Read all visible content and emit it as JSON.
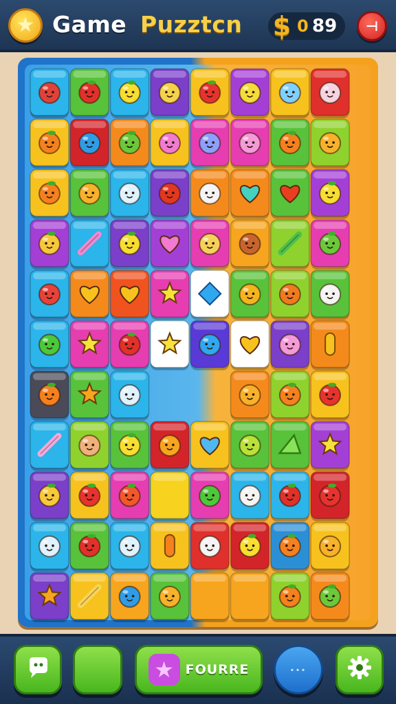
{
  "header": {
    "title_word": "Game",
    "title_name": "Puzztcn",
    "star_icon": "star-icon",
    "coin_icon": "coin-icon",
    "coin_symbol": "$",
    "coin_prefix": "0",
    "coin_count": "89",
    "menu_icon": "menu-icon",
    "menu_glyph": "⊣"
  },
  "board": {
    "columns": 8,
    "rows": 11,
    "grid": [
      [
        {
          "bg": "#2bb5ea",
          "icon": "monster-red"
        },
        {
          "bg": "#58c23a",
          "icon": "apple"
        },
        {
          "bg": "#2bb5ea",
          "icon": "lemon"
        },
        {
          "bg": "#7b3fc9",
          "icon": "potion"
        },
        {
          "bg": "#f7c21e",
          "icon": "strawberry"
        },
        {
          "bg": "#a43fd6",
          "icon": "lemon-smile"
        },
        {
          "bg": "#f7c21e",
          "icon": "cup"
        },
        {
          "bg": "#e0302c",
          "icon": "radish"
        }
      ],
      [
        {
          "bg": "#f7c21e",
          "icon": "orange"
        },
        {
          "bg": "#d3242a",
          "icon": "blue-blob"
        },
        {
          "bg": "#f58a1c",
          "icon": "lime"
        },
        {
          "bg": "#f7c21e",
          "icon": "pink-blob"
        },
        {
          "bg": "#e63db1",
          "icon": "muffin"
        },
        {
          "bg": "#e63db1",
          "icon": "pink-egg"
        },
        {
          "bg": "#58c23a",
          "icon": "orange"
        },
        {
          "bg": "#8fd22e",
          "icon": "orange-ball"
        }
      ],
      [
        {
          "bg": "#f7c21e",
          "icon": "orange"
        },
        {
          "bg": "#58c23a",
          "icon": "orange-ball"
        },
        {
          "bg": "#2bb5ea",
          "icon": "snowflake"
        },
        {
          "bg": "#7b3fc9",
          "icon": "red-drop"
        },
        {
          "bg": "#f58a1c",
          "icon": "radish-white"
        },
        {
          "bg": "#f58a1c",
          "icon": "heart-teal"
        },
        {
          "bg": "#58c23a",
          "icon": "heart-red"
        },
        {
          "bg": "#a43fd6",
          "icon": "lemon"
        }
      ],
      [
        {
          "bg": "#a43fd6",
          "icon": "pineapple"
        },
        {
          "bg": "#2bb5ea",
          "icon": "brush"
        },
        {
          "bg": "#7b3fc9",
          "icon": "lemon"
        },
        {
          "bg": "#a43fd6",
          "icon": "heart-pink"
        },
        {
          "bg": "#e63db1",
          "icon": "peanut"
        },
        {
          "bg": "#f7a51e",
          "icon": "cookie"
        },
        {
          "bg": "#8fd22e",
          "icon": "pencil"
        },
        {
          "bg": "#e63db1",
          "icon": "lime"
        }
      ],
      [
        {
          "bg": "#2bb5ea",
          "icon": "jar-red"
        },
        {
          "bg": "#f58a1c",
          "icon": "heart-yellow"
        },
        {
          "bg": "#f0531e",
          "icon": "heart-yellow"
        },
        {
          "bg": "#e63db1",
          "icon": "star-yellow"
        },
        {
          "bg": "#ffffff",
          "icon": "diamond"
        },
        {
          "bg": "#58c23a",
          "icon": "onion"
        },
        {
          "bg": "#8fd22e",
          "icon": "pumpkin"
        },
        {
          "bg": "#58c23a",
          "icon": "marshmallow"
        }
      ],
      [
        {
          "bg": "#2bb5ea",
          "icon": "green-monster"
        },
        {
          "bg": "#e63db1",
          "icon": "star-yellow"
        },
        {
          "bg": "#e63db1",
          "icon": "apple"
        },
        {
          "bg": "#ffffff",
          "icon": "star-yellow"
        },
        {
          "bg": "#5a3ad6",
          "icon": "drop-blue"
        },
        {
          "bg": "#ffffff",
          "icon": "heart-yellow"
        },
        {
          "bg": "#7b3fc9",
          "icon": "pink-monster"
        },
        {
          "bg": "#f58a1c",
          "icon": "capsule"
        }
      ],
      [
        {
          "bg": "#4a4a58",
          "icon": "orange"
        },
        {
          "bg": "#58c23a",
          "icon": "star-orange"
        },
        {
          "bg": "#2bb5ea",
          "icon": "snowflake"
        },
        null,
        null,
        {
          "bg": "#f58a1c",
          "icon": "orange-ball"
        },
        {
          "bg": "#8fd22e",
          "icon": "orange"
        },
        {
          "bg": "#f7c21e",
          "icon": "tomato"
        }
      ],
      [
        {
          "bg": "#2bb5ea",
          "icon": "candy-stick"
        },
        {
          "bg": "#8fd22e",
          "icon": "teddy"
        },
        {
          "bg": "#58c23a",
          "icon": "lemon"
        },
        {
          "bg": "#d3242a",
          "icon": "balloon"
        },
        {
          "bg": "#f7c21e",
          "icon": "heart-blue"
        },
        {
          "bg": "#58c23a",
          "icon": "slime"
        },
        {
          "bg": "#58c23a",
          "icon": "triangle"
        },
        {
          "bg": "#a43fd6",
          "icon": "sparkle"
        }
      ],
      [
        {
          "bg": "#7b3fc9",
          "icon": "pineapple"
        },
        {
          "bg": "#f7c21e",
          "icon": "tomato"
        },
        {
          "bg": "#e63db1",
          "icon": "orange-red"
        },
        {
          "bg": "#f7d21e",
          "icon": "empty"
        },
        {
          "bg": "#e63db1",
          "icon": "green-monster"
        },
        {
          "bg": "#2bb5ea",
          "icon": "ghost"
        },
        {
          "bg": "#2bb5ea",
          "icon": "apple"
        },
        {
          "bg": "#d3242a",
          "icon": "tomato"
        }
      ],
      [
        {
          "bg": "#2bb5ea",
          "icon": "snowflake"
        },
        {
          "bg": "#58c23a",
          "icon": "apple"
        },
        {
          "bg": "#2bb5ea",
          "icon": "snowflake"
        },
        {
          "bg": "#f7c21e",
          "icon": "carrot"
        },
        {
          "bg": "#e0302c",
          "icon": "ghost"
        },
        {
          "bg": "#d3242a",
          "icon": "lemon"
        },
        {
          "bg": "#2b8fd6",
          "icon": "orange"
        },
        {
          "bg": "#f7c21e",
          "icon": "orange-ball"
        }
      ],
      [
        {
          "bg": "#7b3fc9",
          "icon": "star-orange"
        },
        {
          "bg": "#f7c21e",
          "icon": "stick"
        },
        {
          "bg": "#f7a51e",
          "icon": "blue-blob"
        },
        {
          "bg": "#58c23a",
          "icon": "orange-ball"
        },
        {
          "bg": "#f7a51e",
          "icon": "empty"
        },
        {
          "bg": "#f7a51e",
          "icon": "empty"
        },
        {
          "bg": "#8fd22e",
          "icon": "orange"
        },
        {
          "bg": "#f58a1c",
          "icon": "lime"
        }
      ]
    ]
  },
  "bottom": {
    "chat_icon": "chat-icon",
    "blank_icon": "blank-button",
    "find_icon": "star-icon",
    "find_label": "FOURRE",
    "dots_label": "···",
    "settings_icon": "gear-icon"
  },
  "colors": {
    "header_bg": "#2c4a6e",
    "board_left": "#1f73c9",
    "board_right": "#f4a21e",
    "green_button": "#48b61e",
    "blue_button": "#1d6fcc",
    "coin_gold": "#f3b51f"
  }
}
